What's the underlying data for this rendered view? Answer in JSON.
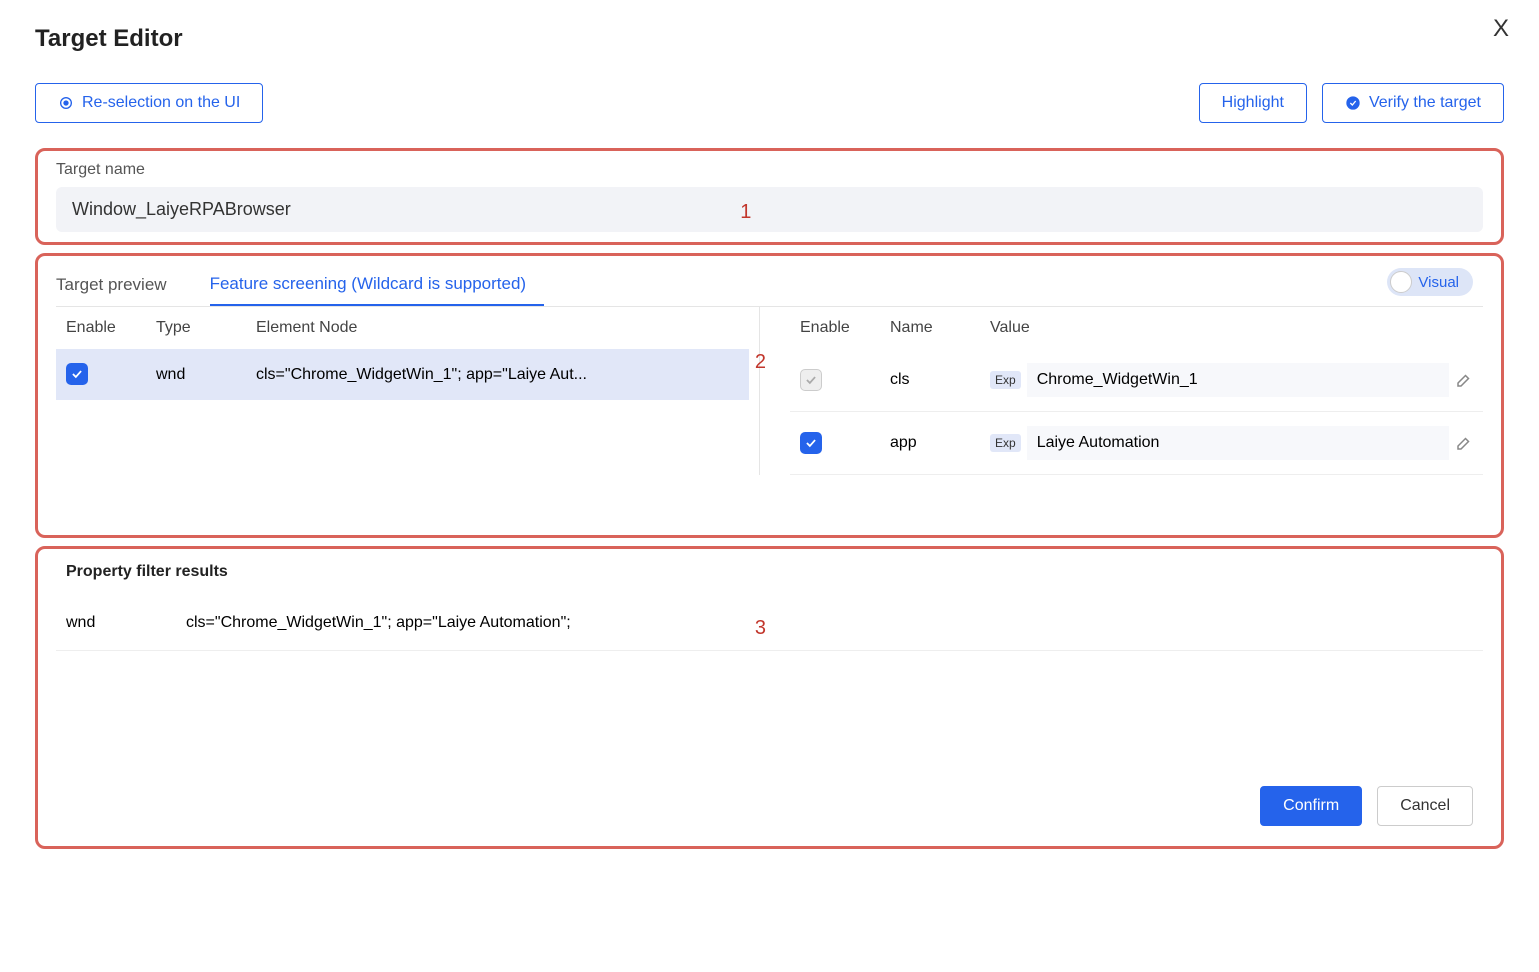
{
  "dialog": {
    "title": "Target Editor",
    "close": "X"
  },
  "actions": {
    "reselection": "Re-selection on the UI",
    "highlight": "Highlight",
    "verify": "Verify the target",
    "confirm": "Confirm",
    "cancel": "Cancel"
  },
  "targetName": {
    "label": "Target name",
    "value": "Window_LaiyeRPABrowser"
  },
  "tabs": {
    "preview": "Target preview",
    "feature": "Feature screening (Wildcard is supported)",
    "visual": "Visual"
  },
  "leftTable": {
    "headers": {
      "enable": "Enable",
      "type": "Type",
      "node": "Element Node"
    },
    "rows": [
      {
        "enabled": true,
        "type": "wnd",
        "node": "cls=\"Chrome_WidgetWin_1\"; app=\"Laiye Aut..."
      }
    ]
  },
  "rightTable": {
    "headers": {
      "enable": "Enable",
      "name": "Name",
      "value": "Value"
    },
    "rows": [
      {
        "enabled": true,
        "disabled": true,
        "name": "cls",
        "badge": "Exp",
        "value": "Chrome_WidgetWin_1"
      },
      {
        "enabled": true,
        "disabled": false,
        "name": "app",
        "badge": "Exp",
        "value": "Laiye Automation"
      }
    ]
  },
  "results": {
    "title": "Property filter results",
    "rows": [
      {
        "type": "wnd",
        "value": "cls=\"Chrome_WidgetWin_1\"; app=\"Laiye Automation\";"
      }
    ]
  },
  "annotations": {
    "n1": "1",
    "n2": "2",
    "n3": "3"
  }
}
